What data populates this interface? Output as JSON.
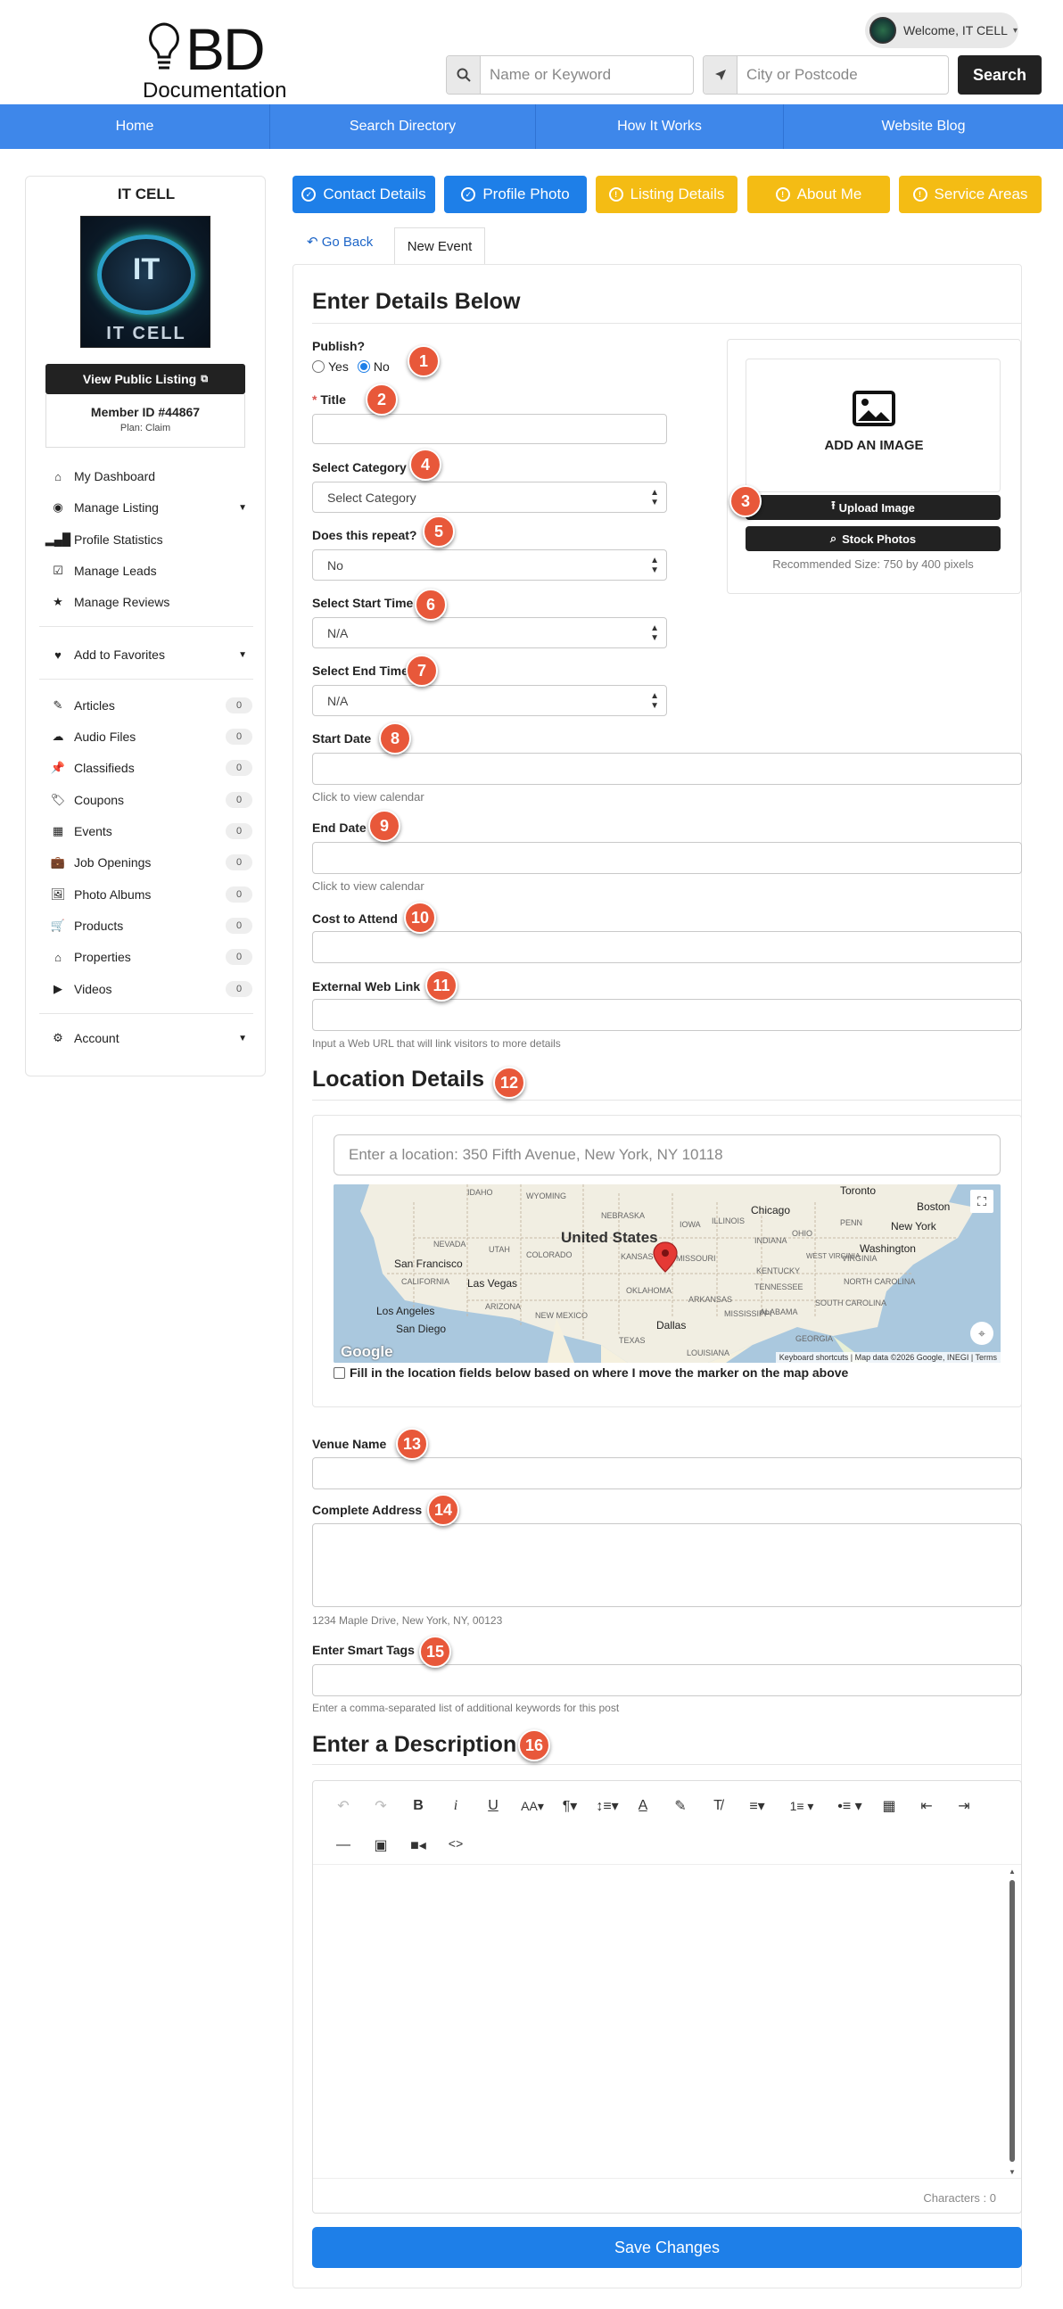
{
  "header": {
    "logo_letters": "BD",
    "logo_text": "Documentation",
    "welcome": "Welcome, IT CELL",
    "keyword_placeholder": "Name or Keyword",
    "location_placeholder": "City or Postcode",
    "search_label": "Search"
  },
  "nav": [
    "Home",
    "Search Directory",
    "How It Works",
    "Website Blog"
  ],
  "sidebar": {
    "name": "IT CELL",
    "avatar_text": "IT",
    "avatar_caption": "IT CELL",
    "view_listing": "View Public Listing",
    "member_id": "Member ID #44867",
    "plan": "Plan: Claim",
    "menu": [
      {
        "label": "My Dashboard",
        "icon": "home-icon"
      },
      {
        "label": "Manage Listing",
        "icon": "user-circle-icon"
      },
      {
        "label": "Profile Statistics",
        "icon": "bar-chart-icon"
      },
      {
        "label": "Manage Leads",
        "icon": "checkbox-icon"
      },
      {
        "label": "Manage Reviews",
        "icon": "star-icon"
      }
    ],
    "favorites": "Add to Favorites",
    "posts": [
      {
        "label": "Articles",
        "count": "0"
      },
      {
        "label": "Audio Files",
        "count": "0"
      },
      {
        "label": "Classifieds",
        "count": "0"
      },
      {
        "label": "Coupons",
        "count": "0"
      },
      {
        "label": "Events",
        "count": "0"
      },
      {
        "label": "Job Openings",
        "count": "0"
      },
      {
        "label": "Photo Albums",
        "count": "0"
      },
      {
        "label": "Products",
        "count": "0"
      },
      {
        "label": "Properties",
        "count": "0"
      },
      {
        "label": "Videos",
        "count": "0"
      }
    ],
    "account": "Account"
  },
  "tabs": {
    "contact": "Contact Details",
    "photo": "Profile Photo",
    "listing": "Listing Details",
    "about": "About Me",
    "service": "Service Areas",
    "go_back": "Go Back",
    "new_event": "New Event"
  },
  "form": {
    "heading": "Enter Details Below",
    "publish": "Publish?",
    "yes": "Yes",
    "no": "No",
    "title": "Title",
    "category_label": "Select Category",
    "category_value": "Select Category",
    "repeat_label": "Does this repeat?",
    "repeat_value": "No",
    "start_time_label": "Select Start Time",
    "start_time_value": "N/A",
    "end_time_label": "Select End Time",
    "end_time_value": "N/A",
    "start_date": "Start Date",
    "start_date_help": "Click to view calendar",
    "end_date": "End Date",
    "end_date_help": "Click to view calendar",
    "cost": "Cost to Attend",
    "web_link": "External Web Link",
    "web_link_help": "Input a Web URL that will link visitors to more details",
    "location_heading": "Location Details",
    "location_placeholder": "Enter a location: 350 Fifth Avenue, New York, NY 10118",
    "map_checkbox": "Fill in the location fields below based on where I move the marker on the map above",
    "venue": "Venue Name",
    "address": "Complete Address",
    "address_help": "1234 Maple Drive, New York, NY, 00123",
    "tags": "Enter Smart Tags",
    "tags_help": "Enter a comma-separated list of additional keywords for this post",
    "desc_heading": "Enter a Description",
    "characters": "Characters : 0",
    "save": "Save Changes"
  },
  "image": {
    "add": "ADD AN IMAGE",
    "upload": "Upload Image",
    "stock": "Stock Photos",
    "recommended": "Recommended Size: 750 by 400 pixels"
  },
  "map": {
    "labels": [
      "United States",
      "Chicago",
      "New York",
      "Boston",
      "Washington",
      "San Francisco",
      "Las Vegas",
      "Los Angeles",
      "San Diego",
      "Dallas",
      "NEBRASKA",
      "KANSAS",
      "MISSOURI",
      "IOWA",
      "ILLINOIS",
      "OHIO",
      "PENN",
      "INDIANA",
      "VIRGINIA",
      "KENTUCKY",
      "TENNESSEE",
      "COLORADO",
      "UTAH",
      "NEVADA",
      "CALIFORNIA",
      "ARIZONA",
      "NEW MEXICO",
      "OKLAHOMA",
      "ARKANSAS",
      "TEXAS",
      "MISSISSIPPI",
      "ALABAMA",
      "GEORGIA",
      "LOUISIANA",
      "NORTH CAROLINA",
      "SOUTH CAROLINA",
      "WYOMING",
      "IDAHO",
      "Toronto",
      "WEST VIRGINIA"
    ],
    "google": "Google",
    "attribution": "Keyboard shortcuts | Map data ©2026 Google, INEGI | Terms"
  },
  "badges": [
    "1",
    "2",
    "3",
    "4",
    "5",
    "6",
    "7",
    "8",
    "9",
    "10",
    "11",
    "12",
    "13",
    "14",
    "15",
    "16"
  ],
  "colors": {
    "accent": "#1e7fe8",
    "nav": "#3e87ea",
    "yellow": "#f4bc14",
    "badge": "#e8583a"
  }
}
